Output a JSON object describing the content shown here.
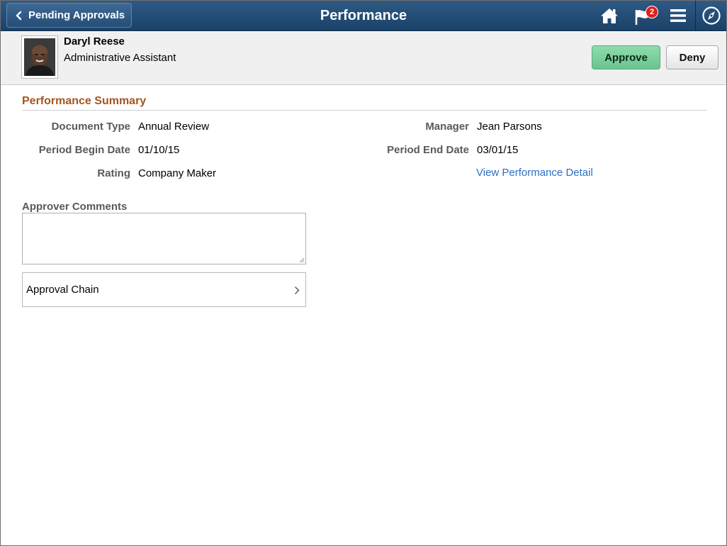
{
  "banner": {
    "back_label": "Pending Approvals",
    "title": "Performance",
    "notification_count": "2",
    "icons": [
      "chevron-left-icon",
      "home-icon",
      "flag-icon",
      "hamburger-menu-icon",
      "compass-icon"
    ]
  },
  "employee": {
    "name": "Daryl Reese",
    "job_title": "Administrative Assistant"
  },
  "actions": {
    "approve_label": "Approve",
    "deny_label": "Deny"
  },
  "summary": {
    "title": "Performance Summary",
    "document_type_label": "Document Type",
    "document_type": "Annual Review",
    "period_begin_label": "Period Begin Date",
    "period_begin": "01/10/15",
    "rating_label": "Rating",
    "rating": "Company Maker",
    "manager_label": "Manager",
    "manager": "Jean Parsons",
    "period_end_label": "Period End Date",
    "period_end": "03/01/15",
    "detail_link": "View Performance Detail"
  },
  "comments": {
    "label": "Approver Comments",
    "value": ""
  },
  "approval_chain": {
    "label": "Approval Chain"
  },
  "colors": {
    "banner": "#1b4268",
    "approve": "#69c48f",
    "section_title": "#a3551f",
    "link": "#2a6fc4",
    "badge": "#e0201b"
  }
}
